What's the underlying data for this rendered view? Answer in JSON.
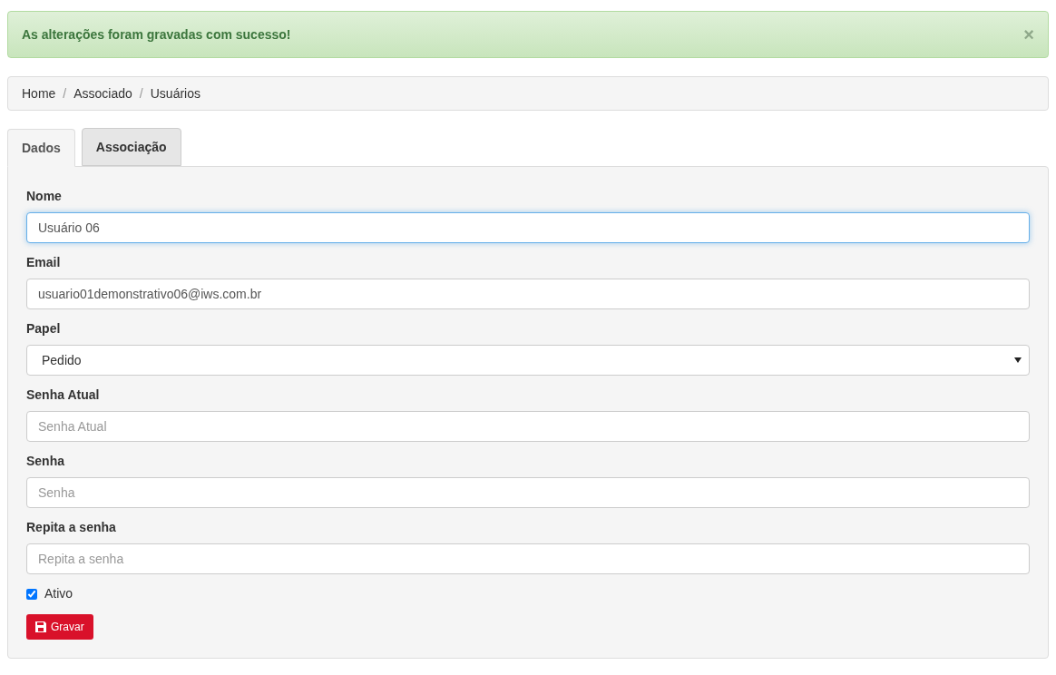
{
  "alert": {
    "message": "As alterações foram gravadas com sucesso!",
    "close": "×"
  },
  "breadcrumb": {
    "separator": "/",
    "items": [
      "Home",
      "Associado",
      "Usuários"
    ]
  },
  "tabs": [
    {
      "label": "Dados",
      "selected": true
    },
    {
      "label": "Associação",
      "selected": false
    }
  ],
  "form": {
    "fields": [
      {
        "kind": "text",
        "label": "Nome",
        "value": "Usuário 06",
        "focused": true
      },
      {
        "kind": "text",
        "label": "Email",
        "value": "usuario01demonstrativo06@iws.com.br",
        "focused": false
      },
      {
        "kind": "select",
        "label": "Papel",
        "value": "Pedido",
        "focused": false
      },
      {
        "kind": "text",
        "label": "Senha Atual",
        "placeholder": "Senha Atual",
        "focused": false
      },
      {
        "kind": "text",
        "label": "Senha",
        "placeholder": "Senha",
        "focused": false
      },
      {
        "kind": "text",
        "label": "Repita a senha",
        "placeholder": "Repita a senha",
        "focused": false
      }
    ],
    "checkbox": {
      "label": "Ativo",
      "checked": true
    },
    "submit": "Gravar"
  }
}
